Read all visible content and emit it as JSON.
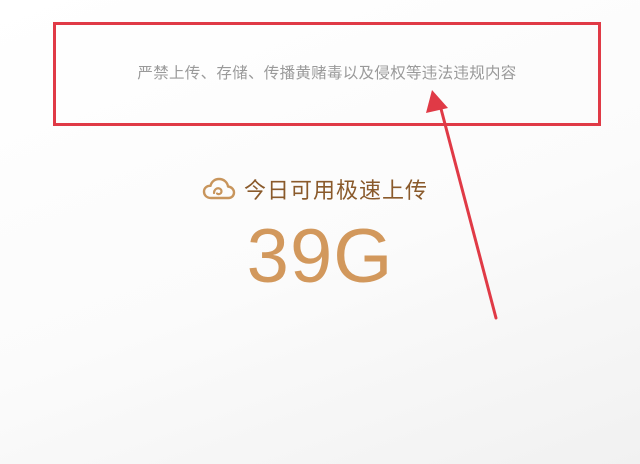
{
  "notice": {
    "text": "严禁上传、存储、传播黄赌毒以及侵权等违法违规内容"
  },
  "quota": {
    "label": "今日可用极速上传",
    "value": "39G"
  },
  "colors": {
    "annotation_red": "#e03a46",
    "accent_gold": "#d2985c",
    "label_brown": "#8a5a2b",
    "notice_gray": "#9a9a9a"
  },
  "icons": {
    "quota": "cloud-icon"
  }
}
